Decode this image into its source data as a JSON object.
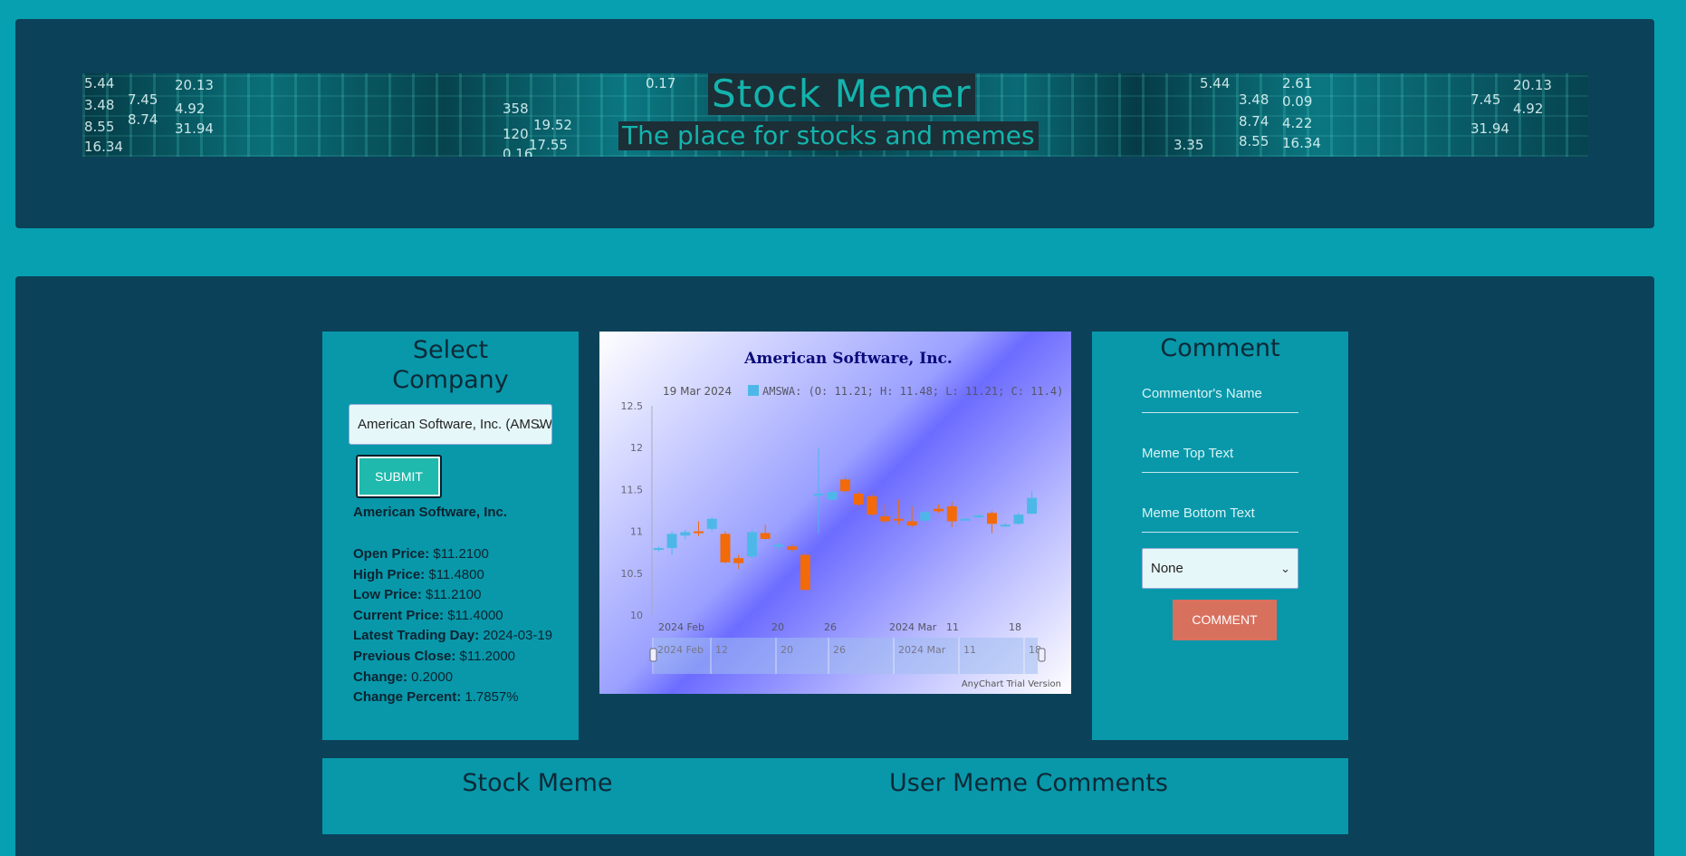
{
  "header": {
    "title": "Stock Memer",
    "tagline": "The place for stocks and memes",
    "banner_numbers": [
      "5.44",
      "3.48",
      "8.55",
      "16.34",
      "20.13",
      "7.45",
      "8.74",
      "4.92",
      "31.94",
      "0.17",
      "358",
      "19.52",
      "120",
      "17.55",
      "0.16",
      "5.44",
      "2.61",
      "3.48",
      "0.09",
      "8.74",
      "4.22",
      "8.55",
      "16.34",
      "20.13",
      "7.45",
      "4.92",
      "31.94",
      "3.35"
    ]
  },
  "select_company": {
    "title": "Select Company",
    "selected_company": "American Software, Inc. (AMSWA)",
    "submit_label": "SUBMIT",
    "company_name": "American Software, Inc.",
    "details": [
      {
        "label": "Open Price:",
        "value": "$11.2100"
      },
      {
        "label": "High Price:",
        "value": "$11.4800"
      },
      {
        "label": "Low Price:",
        "value": "$11.2100"
      },
      {
        "label": "Current Price:",
        "value": "$11.4000"
      },
      {
        "label": "Latest Trading Day:",
        "value": "2024-03-19"
      },
      {
        "label": "Previous Close:",
        "value": "$11.2000"
      },
      {
        "label": "Change:",
        "value": "0.2000"
      },
      {
        "label": "Change Percent:",
        "value": "1.7857%"
      }
    ]
  },
  "chart_data": {
    "type": "candlestick",
    "title": "American Software, Inc.",
    "tooltip_date": "19 Mar 2024",
    "legend": "AMSWA: (O: 11.21; H: 11.48; L: 11.21; C: 11.4)",
    "ylim": [
      10,
      12.5
    ],
    "y_ticks": [
      "12.5",
      "12",
      "11.5",
      "11",
      "10.5",
      "10"
    ],
    "x_ticks": [
      "2024 Feb",
      "20",
      "26",
      "2024 Mar",
      "11",
      "18"
    ],
    "scroller_ticks": [
      "2024 Feb",
      "12",
      "20",
      "26",
      "2024 Mar",
      "11",
      "18"
    ],
    "watermark": "AnyChart Trial Version",
    "up_color": "#4db8e8",
    "down_color": "#f26a0a",
    "candles": [
      {
        "o": 10.78,
        "h": 10.82,
        "l": 10.76,
        "c": 10.8
      },
      {
        "o": 10.8,
        "h": 11.0,
        "l": 10.72,
        "c": 10.97
      },
      {
        "o": 10.95,
        "h": 11.02,
        "l": 10.9,
        "c": 10.99
      },
      {
        "o": 11.0,
        "h": 11.12,
        "l": 10.94,
        "c": 10.98
      },
      {
        "o": 11.03,
        "h": 11.17,
        "l": 11.0,
        "c": 11.15
      },
      {
        "o": 10.97,
        "h": 11.0,
        "l": 10.62,
        "c": 10.63
      },
      {
        "o": 10.68,
        "h": 10.72,
        "l": 10.55,
        "c": 10.62
      },
      {
        "o": 10.7,
        "h": 11.02,
        "l": 10.68,
        "c": 10.99
      },
      {
        "o": 10.98,
        "h": 11.08,
        "l": 10.9,
        "c": 10.91
      },
      {
        "o": 10.82,
        "h": 10.86,
        "l": 10.78,
        "c": 10.84
      },
      {
        "o": 10.82,
        "h": 10.85,
        "l": 10.75,
        "c": 10.78
      },
      {
        "o": 10.72,
        "h": 10.75,
        "l": 10.3,
        "c": 10.3
      },
      {
        "o": 11.45,
        "h": 12.0,
        "l": 10.98,
        "c": 11.45
      },
      {
        "o": 11.38,
        "h": 11.48,
        "l": 11.36,
        "c": 11.47
      },
      {
        "o": 11.62,
        "h": 11.65,
        "l": 11.45,
        "c": 11.48
      },
      {
        "o": 11.45,
        "h": 11.47,
        "l": 11.3,
        "c": 11.32
      },
      {
        "o": 11.42,
        "h": 11.45,
        "l": 11.18,
        "c": 11.2
      },
      {
        "o": 11.18,
        "h": 11.32,
        "l": 11.1,
        "c": 11.12
      },
      {
        "o": 11.15,
        "h": 11.38,
        "l": 11.08,
        "c": 11.14
      },
      {
        "o": 11.12,
        "h": 11.3,
        "l": 11.05,
        "c": 11.07
      },
      {
        "o": 11.13,
        "h": 11.25,
        "l": 11.1,
        "c": 11.23
      },
      {
        "o": 11.27,
        "h": 11.32,
        "l": 11.22,
        "c": 11.24
      },
      {
        "o": 11.3,
        "h": 11.35,
        "l": 11.05,
        "c": 11.12
      },
      {
        "o": 11.14,
        "h": 11.17,
        "l": 11.12,
        "c": 11.15
      },
      {
        "o": 11.18,
        "h": 11.2,
        "l": 11.16,
        "c": 11.19
      },
      {
        "o": 11.22,
        "h": 11.24,
        "l": 10.98,
        "c": 11.09
      },
      {
        "o": 11.07,
        "h": 11.1,
        "l": 11.05,
        "c": 11.08
      },
      {
        "o": 11.09,
        "h": 11.22,
        "l": 11.08,
        "c": 11.2
      },
      {
        "o": 11.21,
        "h": 11.48,
        "l": 11.21,
        "c": 11.4
      }
    ]
  },
  "comment_form": {
    "title": "Comment",
    "name_placeholder": "Commentor's Name",
    "top_text_placeholder": "Meme Top Text",
    "bottom_text_placeholder": "Meme Bottom Text",
    "meme_selected": "None",
    "submit_label": "COMMENT"
  },
  "bottom": {
    "stock_meme_title": "Stock Meme",
    "user_comments_title": "User Meme Comments"
  }
}
